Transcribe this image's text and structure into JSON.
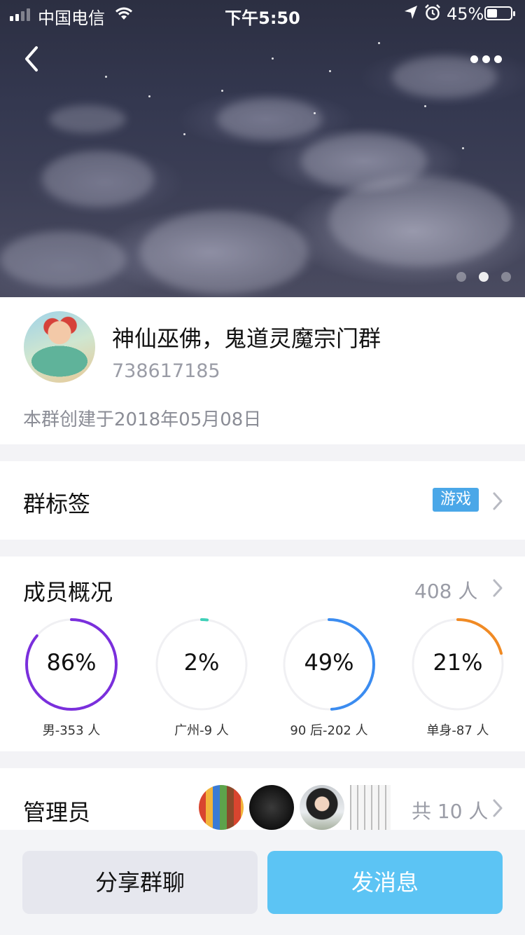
{
  "status_bar": {
    "carrier": "中国电信",
    "time": "下午5:50",
    "battery": "45%"
  },
  "hero": {
    "page_count": 3,
    "active_page": 2
  },
  "group": {
    "name": "神仙巫佛，鬼道灵魔宗门群",
    "id": "738617185",
    "created": "本群创建于2018年05月08日"
  },
  "tags": {
    "title": "群标签",
    "tag": "游戏",
    "tag_color": "#4aa7e8"
  },
  "members": {
    "title": "成员概况",
    "count": "408 人",
    "stats": [
      {
        "percent": "86%",
        "value": 0.86,
        "label": "男-353 人",
        "color": "#7a2fdc"
      },
      {
        "percent": "2%",
        "value": 0.02,
        "label": "广州-9 人",
        "color": "#3fd0b8"
      },
      {
        "percent": "49%",
        "value": 0.49,
        "label": "90 后-202 人",
        "color": "#3b8cf0"
      },
      {
        "percent": "21%",
        "value": 0.21,
        "label": "单身-87 人",
        "color": "#f08a24"
      }
    ]
  },
  "admins": {
    "title": "管理员",
    "count": "共 10 人"
  },
  "actions": {
    "share_label": "分享群聊",
    "send_label": "发消息",
    "send_color": "#5cc4f4"
  }
}
